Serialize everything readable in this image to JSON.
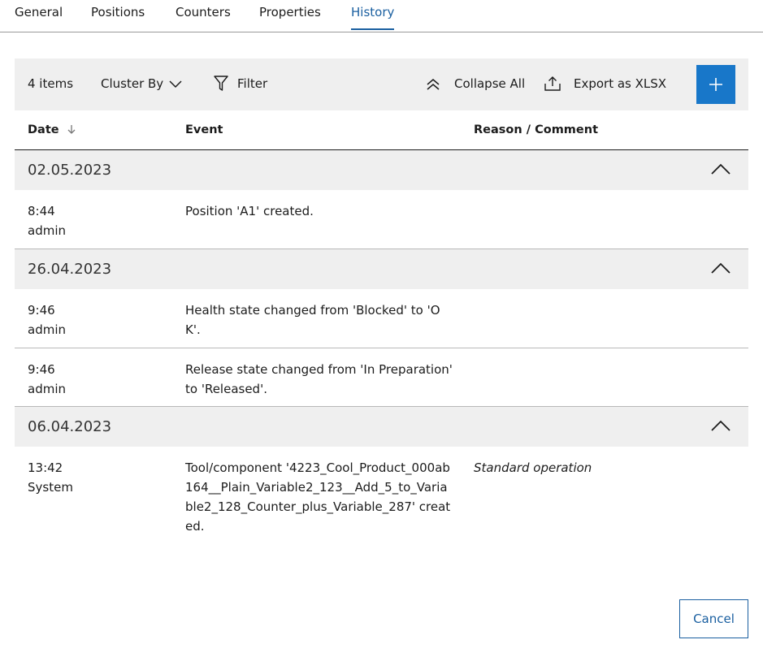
{
  "tabs": [
    {
      "label": "General"
    },
    {
      "label": "Positions"
    },
    {
      "label": "Counters"
    },
    {
      "label": "Properties"
    },
    {
      "label": "History"
    }
  ],
  "active_tab": "History",
  "toolbar": {
    "count": "4 items",
    "cluster_by": "Cluster By",
    "filter": "Filter",
    "collapse_all": "Collapse All",
    "export": "Export as XLSX",
    "add_icon": "plus-icon",
    "accent": "#1877c9"
  },
  "table": {
    "headers": {
      "date": "Date",
      "event": "Event",
      "reason": "Reason / Comment"
    },
    "sort_icon": "arrow-down-icon",
    "groups": [
      {
        "date": "02.05.2023",
        "rows": [
          {
            "time": "8:44",
            "user": "admin",
            "event": "Position 'A1' created.",
            "reason": ""
          }
        ]
      },
      {
        "date": "26.04.2023",
        "rows": [
          {
            "time": "9:46",
            "user": "admin",
            "event": "Health state changed from 'Blocked' to 'OK'.",
            "reason": ""
          },
          {
            "time": "9:46",
            "user": "admin",
            "event": "Release state changed from 'In Preparation' to 'Released'.",
            "reason": ""
          }
        ]
      },
      {
        "date": "06.04.2023",
        "rows": [
          {
            "time": "13:42",
            "user": "System",
            "event": "Tool/component '4223_Cool_Product_000ab164__Plain_Variable2_123__Add_5_to_Variable2_128_Counter_plus_Variable_287' created.",
            "reason": "Standard operation"
          }
        ]
      }
    ]
  },
  "footer": {
    "cancel": "Cancel"
  }
}
